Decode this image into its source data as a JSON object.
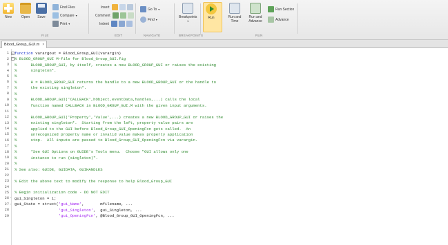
{
  "toolstrip": {
    "file": {
      "new_label": "New",
      "open_label": "Open",
      "save_label": "Save",
      "find_files_label": "Find Files",
      "compare_label": "Compare",
      "print_label": "Print",
      "section_label": "FILE"
    },
    "edit": {
      "insert_label": "Insert",
      "comment_label": "Comment",
      "indent_label": "Indent",
      "section_label": "EDIT"
    },
    "navigate": {
      "goto_label": "Go To",
      "find_label": "Find",
      "section_label": "NAVIGATE"
    },
    "breakpoints": {
      "breakpoints_label": "Breakpoints",
      "section_label": "BREAKPOINTS"
    },
    "run": {
      "run_label": "Run",
      "run_and_time_label": "Run and Time",
      "run_and_advance_label": "Run and Advance",
      "run_section_label": "Run Section",
      "advance_label": "Advance",
      "section_label": "RUN"
    }
  },
  "tabs": [
    {
      "label": "Blood_Group_GUI.m",
      "close": "×"
    }
  ],
  "editor": {
    "lines": [
      {
        "n": "1",
        "mark": "",
        "segs": [
          {
            "t": "function",
            "k": "keyword"
          },
          {
            "t": " varargout = Blood_Group_GUI(varargin)",
            "k": "plain"
          }
        ]
      },
      {
        "n": "2",
        "mark": "",
        "segs": [
          {
            "t": "% BLOOD_GROUP_GUI M-file for Blood_Group_GUI.fig",
            "k": "comment"
          }
        ]
      },
      {
        "n": "3",
        "mark": "",
        "segs": [
          {
            "t": "%      BLOOD_GROUP_GUI, by itself, creates a new BLOOD_GROUP_GUI or raises the existing",
            "k": "comment"
          }
        ]
      },
      {
        "n": "4",
        "mark": "",
        "segs": [
          {
            "t": "%      singleton*.",
            "k": "comment"
          }
        ]
      },
      {
        "n": "5",
        "mark": "",
        "segs": [
          {
            "t": "%",
            "k": "comment"
          }
        ]
      },
      {
        "n": "6",
        "mark": "",
        "segs": [
          {
            "t": "%      H = BLOOD_GROUP_GUI returns the handle to a new BLOOD_GROUP_GUI or the handle to",
            "k": "comment"
          }
        ]
      },
      {
        "n": "7",
        "mark": "",
        "segs": [
          {
            "t": "%      the existing singleton*.",
            "k": "comment"
          }
        ]
      },
      {
        "n": "8",
        "mark": "",
        "segs": [
          {
            "t": "%",
            "k": "comment"
          }
        ]
      },
      {
        "n": "9",
        "mark": "",
        "segs": [
          {
            "t": "%      BLOOD_GROUP_GUI('CALLBACK',hObject,eventData,handles,...) calls the local",
            "k": "comment"
          }
        ]
      },
      {
        "n": "10",
        "mark": "",
        "segs": [
          {
            "t": "%      function named CALLBACK in BLOOD_GROUP_GUI.M with the given input arguments.",
            "k": "comment"
          }
        ]
      },
      {
        "n": "11",
        "mark": "",
        "segs": [
          {
            "t": "%",
            "k": "comment"
          }
        ]
      },
      {
        "n": "12",
        "mark": "",
        "segs": [
          {
            "t": "%      BLOOD_GROUP_GUI('Property','Value',...) creates a new BLOOD_GROUP_GUI or raises the",
            "k": "comment"
          }
        ]
      },
      {
        "n": "13",
        "mark": "",
        "segs": [
          {
            "t": "%      existing singleton*.  Starting from the left, property value pairs are",
            "k": "comment"
          }
        ]
      },
      {
        "n": "14",
        "mark": "",
        "segs": [
          {
            "t": "%      applied to the GUI before Blood_Group_GUI_OpeningFcn gets called.  An",
            "k": "comment"
          }
        ]
      },
      {
        "n": "15",
        "mark": "",
        "segs": [
          {
            "t": "%      unrecognized property name or invalid value makes property application",
            "k": "comment"
          }
        ]
      },
      {
        "n": "16",
        "mark": "",
        "segs": [
          {
            "t": "%      stop.  All inputs are passed to Blood_Group_GUI_OpeningFcn via varargin.",
            "k": "comment"
          }
        ]
      },
      {
        "n": "17",
        "mark": "",
        "segs": [
          {
            "t": "%",
            "k": "comment"
          }
        ]
      },
      {
        "n": "18",
        "mark": "",
        "segs": [
          {
            "t": "%      *See GUI Options on GUIDE's Tools menu.  Choose \"GUI allows only one",
            "k": "comment"
          }
        ]
      },
      {
        "n": "19",
        "mark": "",
        "segs": [
          {
            "t": "%      instance to run (singleton)\".",
            "k": "comment"
          }
        ]
      },
      {
        "n": "20",
        "mark": "",
        "segs": [
          {
            "t": "%",
            "k": "comment"
          }
        ]
      },
      {
        "n": "21",
        "mark": "",
        "segs": [
          {
            "t": "% See also: GUIDE, GUIDATA, GUIHANDLES",
            "k": "comment"
          }
        ]
      },
      {
        "n": "22",
        "mark": "",
        "segs": [
          {
            "t": "",
            "k": "plain"
          }
        ]
      },
      {
        "n": "23",
        "mark": "",
        "segs": [
          {
            "t": "% Edit the above text to modify the response to help Blood_Group_GUI",
            "k": "comment"
          }
        ]
      },
      {
        "n": "24",
        "mark": "",
        "segs": [
          {
            "t": "",
            "k": "plain"
          }
        ]
      },
      {
        "n": "25",
        "mark": "",
        "segs": [
          {
            "t": "% Begin initialization code - DO NOT EDIT",
            "k": "comment"
          }
        ]
      },
      {
        "n": "26",
        "mark": "-",
        "segs": [
          {
            "t": "gui_Singleton = 1;",
            "k": "plain"
          }
        ]
      },
      {
        "n": "27",
        "mark": "-",
        "segs": [
          {
            "t": "gui_State = struct(",
            "k": "plain"
          },
          {
            "t": "'gui_Name'",
            "k": "string"
          },
          {
            "t": ",       mfilename, ...",
            "k": "plain"
          }
        ]
      },
      {
        "n": "28",
        "mark": "",
        "segs": [
          {
            "t": "                   ",
            "k": "plain"
          },
          {
            "t": "'gui_Singleton'",
            "k": "string"
          },
          {
            "t": ",  gui_Singleton, ...",
            "k": "plain"
          }
        ]
      },
      {
        "n": "29",
        "mark": "",
        "segs": [
          {
            "t": "                   ",
            "k": "plain"
          },
          {
            "t": "'gui_OpeningFcn'",
            "k": "string"
          },
          {
            "t": ", @Blood_Group_GUI_OpeningFcn, ...",
            "k": "plain"
          }
        ]
      }
    ]
  },
  "colors": {
    "comment": "#2f8a2f",
    "keyword": "#1a33cc",
    "string": "#a020f0",
    "run_highlight": "#ffe6a3"
  }
}
